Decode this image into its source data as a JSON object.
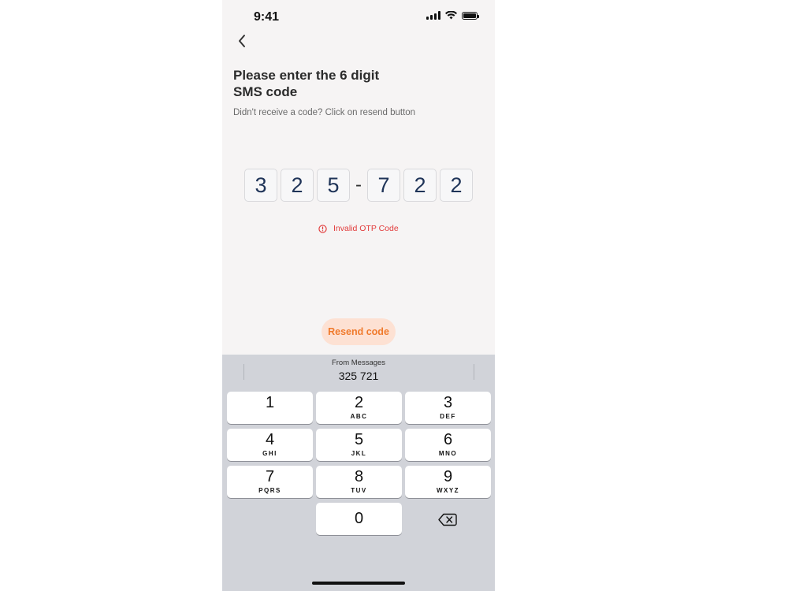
{
  "status_bar": {
    "time": "9:41"
  },
  "header": {
    "title_line1": "Please enter the 6 digit",
    "title_line2": "SMS code",
    "subtitle": "Didn't receive  a code? Click on resend button"
  },
  "otp": {
    "digits": [
      "3",
      "2",
      "5",
      "7",
      "2",
      "2"
    ],
    "separator": "-"
  },
  "error": {
    "message": "Invalid OTP Code",
    "color": "#e23b3b"
  },
  "resend": {
    "label": "Resend code",
    "color": "#f07a2c",
    "bg": "#fde1d3"
  },
  "keyboard": {
    "suggestion_label": "From Messages",
    "suggestion_value": "325 721",
    "keys": [
      {
        "digit": "1",
        "letters": ""
      },
      {
        "digit": "2",
        "letters": "ABC"
      },
      {
        "digit": "3",
        "letters": "DEF"
      },
      {
        "digit": "4",
        "letters": "GHI"
      },
      {
        "digit": "5",
        "letters": "JKL"
      },
      {
        "digit": "6",
        "letters": "MNO"
      },
      {
        "digit": "7",
        "letters": "PQRS"
      },
      {
        "digit": "8",
        "letters": "TUV"
      },
      {
        "digit": "9",
        "letters": "WXYZ"
      },
      {
        "digit": "0",
        "letters": ""
      }
    ],
    "delete_icon": "backspace-icon"
  }
}
